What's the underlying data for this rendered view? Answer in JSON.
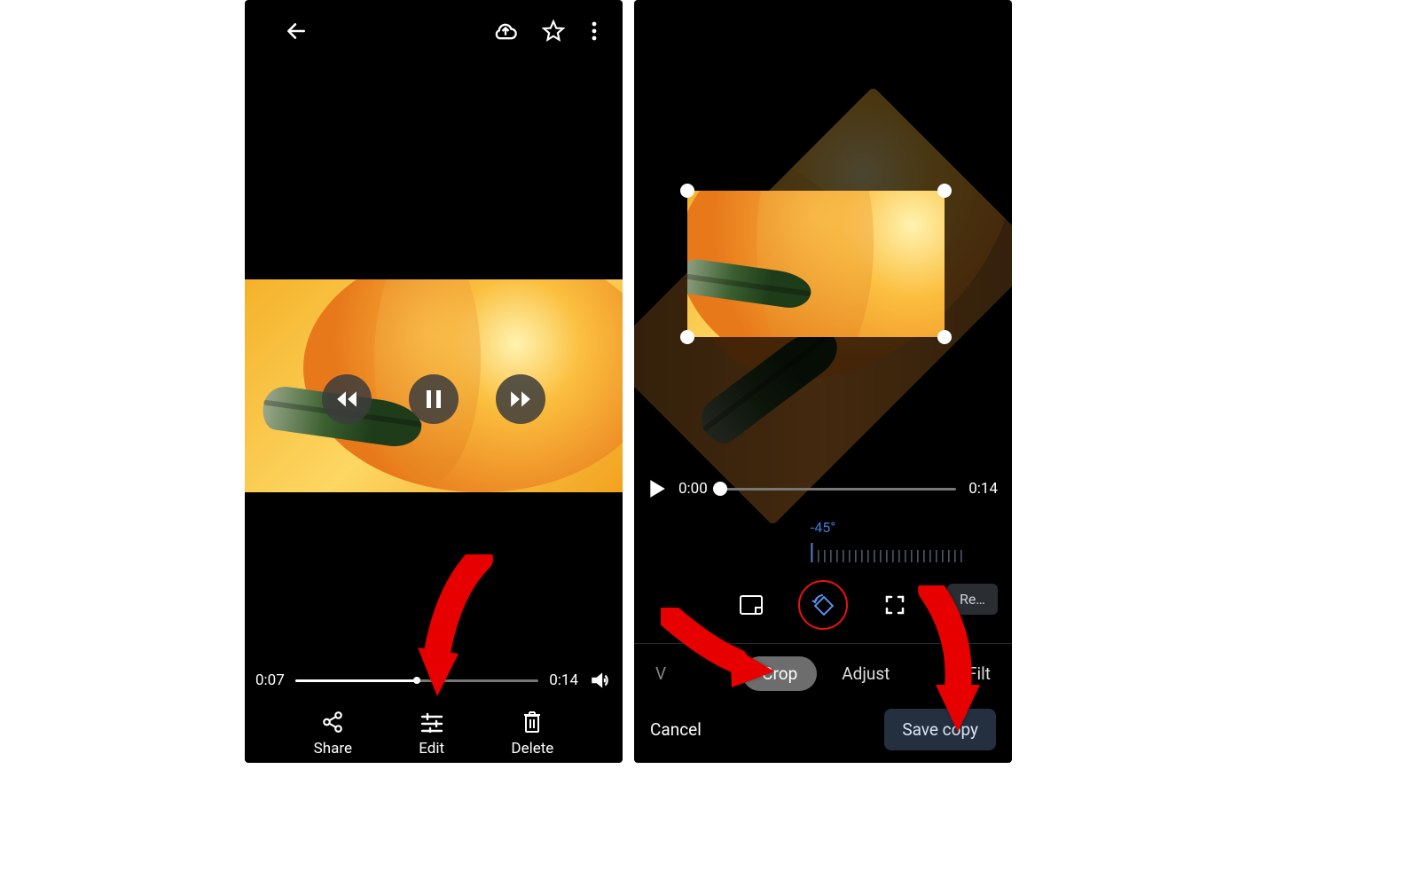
{
  "left": {
    "playback": {
      "current": "0:07",
      "duration": "0:14",
      "progress_pct": 50
    },
    "actions": {
      "share": "Share",
      "edit": "Edit",
      "delete": "Delete"
    }
  },
  "right": {
    "playback": {
      "current": "0:00",
      "duration": "0:14",
      "progress_pct": 0
    },
    "rotation": {
      "angle_label": "-45°",
      "angle_value": -45
    },
    "reset_label": "Re…",
    "tabs": {
      "video_partial": "V",
      "crop": "Crop",
      "adjust": "Adjust",
      "filters_partial": "Filt"
    },
    "footer": {
      "cancel": "Cancel",
      "save": "Save copy"
    }
  }
}
